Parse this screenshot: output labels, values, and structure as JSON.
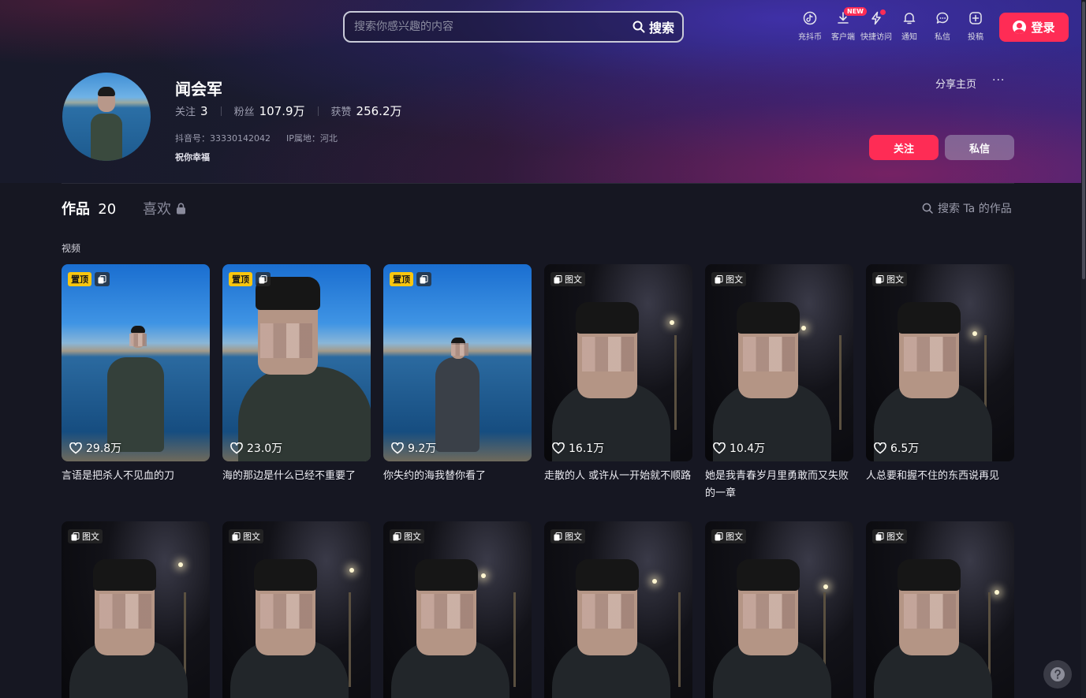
{
  "search": {
    "placeholder": "搜索你感兴趣的内容",
    "button_label": "搜索"
  },
  "nav": [
    {
      "label": "充抖币",
      "icon": "douyin-coin-icon"
    },
    {
      "label": "客户端",
      "icon": "download-icon",
      "badge": "NEW"
    },
    {
      "label": "快捷访问",
      "icon": "lightning-icon"
    },
    {
      "label": "通知",
      "icon": "bell-icon"
    },
    {
      "label": "私信",
      "icon": "chat-bubble-icon"
    },
    {
      "label": "投稿",
      "icon": "plus-square-icon"
    }
  ],
  "login": {
    "label": "登录"
  },
  "profile": {
    "name": "闻会军",
    "following_label": "关注",
    "following": "3",
    "followers_label": "粉丝",
    "followers": "107.9万",
    "likes_label": "获赞",
    "likes": "256.2万",
    "douyin_id": "抖音号：33330142042",
    "ip": "IP属地：河北",
    "bio": "祝你幸福",
    "share_label": "分享主页",
    "more_label": "···",
    "follow_label": "关注",
    "message_label": "私信"
  },
  "tabs": {
    "works_label": "作品",
    "works_count": "20",
    "likes_label": "喜欢",
    "search_works": "搜索 Ta 的作品"
  },
  "section_label": "视频",
  "pinned_label": "置顶",
  "image_post_label": "图文",
  "posts": [
    {
      "likes": "29.8万",
      "title": "言语是把杀人不见血的刀",
      "pinned": true,
      "scene": "day"
    },
    {
      "likes": "23.0万",
      "title": "海的那边是什么已经不重要了",
      "pinned": true,
      "scene": "day"
    },
    {
      "likes": "9.2万",
      "title": "你失约的海我替你看了",
      "pinned": true,
      "scene": "day"
    },
    {
      "likes": "16.1万",
      "title": "走散的人 或许从一开始就不顺路",
      "pinned": false,
      "scene": "night"
    },
    {
      "likes": "10.4万",
      "title": "她是我青春岁月里勇敢而又失败的一章",
      "pinned": false,
      "scene": "night"
    },
    {
      "likes": "6.5万",
      "title": "人总要和握不住的东西说再见",
      "pinned": false,
      "scene": "night"
    },
    {
      "likes": "",
      "title": "",
      "pinned": false,
      "scene": "night"
    },
    {
      "likes": "",
      "title": "",
      "pinned": false,
      "scene": "night"
    },
    {
      "likes": "",
      "title": "",
      "pinned": false,
      "scene": "night"
    },
    {
      "likes": "",
      "title": "",
      "pinned": false,
      "scene": "night"
    },
    {
      "likes": "",
      "title": "",
      "pinned": false,
      "scene": "night"
    },
    {
      "likes": "",
      "title": "",
      "pinned": false,
      "scene": "night"
    }
  ],
  "help_label": "?"
}
